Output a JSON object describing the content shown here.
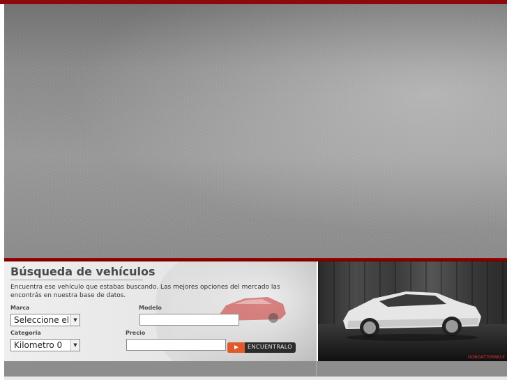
{
  "search": {
    "title": "Búsqueda de vehículos",
    "description": "Encuentra ese vehículo que estabas buscando. Las mejores opciones del mercado las encontrás en nuestra base de datos.",
    "marca_label": "Marca",
    "marca_value": "Seleccione el r",
    "modelo_label": "Modelo",
    "modelo_value": "",
    "categoria_label": "Categoria",
    "categoria_value": "Kilometro 0",
    "precio_label": "Precio",
    "precio_value": "",
    "find_button": "ENCUENTRALO"
  },
  "showcase": {
    "credit": "DONGATTORAKLE"
  },
  "colors": {
    "accent_red": "#8c0a0a",
    "button_orange": "#e05a2a"
  }
}
